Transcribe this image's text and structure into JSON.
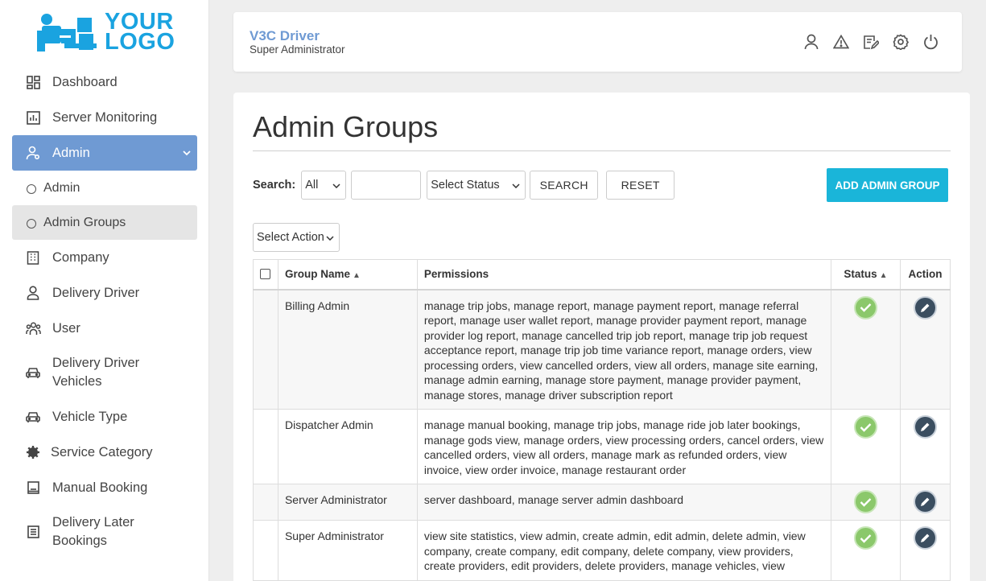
{
  "brand": {
    "logo_line1": "YOUR",
    "logo_line2": "LOGO",
    "accent": "#1aa3e0"
  },
  "sidebar": {
    "items": [
      {
        "label": "Dashboard",
        "icon": "dashboard-icon"
      },
      {
        "label": "Server Monitoring",
        "icon": "chart-icon"
      },
      {
        "label": "Admin",
        "icon": "admin-user-icon",
        "expanded": true
      },
      {
        "label": "Admin",
        "icon": "circle-icon",
        "sub": true
      },
      {
        "label": "Admin Groups",
        "icon": "circle-icon",
        "sub": true,
        "current": true
      },
      {
        "label": "Company",
        "icon": "building-icon"
      },
      {
        "label": "Delivery Driver",
        "icon": "user-icon"
      },
      {
        "label": "User",
        "icon": "users-icon"
      },
      {
        "label": "Delivery Driver Vehicles",
        "icon": "car-icon"
      },
      {
        "label": "Vehicle Type",
        "icon": "car-icon"
      },
      {
        "label": "Service Category",
        "icon": "gear-icon"
      },
      {
        "label": "Manual Booking",
        "icon": "booking-icon"
      },
      {
        "label": "Delivery Later Bookings",
        "icon": "list-icon"
      }
    ]
  },
  "header": {
    "title": "V3C Driver",
    "subtitle": "Super Administrator",
    "icons": [
      "profile-icon",
      "warning-icon",
      "edit-note-icon",
      "settings-icon",
      "power-icon"
    ]
  },
  "main": {
    "title": "Admin Groups",
    "search_label": "Search:",
    "search_field_value": "All",
    "search_input_value": "",
    "status_select_value": "Select Status",
    "search_button": "SEARCH",
    "reset_button": "RESET",
    "add_button": "ADD ADMIN GROUP",
    "action_select_value": "Select Action",
    "columns": [
      "Group Name",
      "Permissions",
      "Status",
      "Action"
    ],
    "rows": [
      {
        "name": "Billing Admin",
        "permissions": "manage trip jobs, manage report, manage payment report, manage referral report, manage user wallet report, manage provider payment report, manage provider log report, manage cancelled trip job report, manage trip job request acceptance report, manage trip job time variance report, manage orders, view processing orders, view cancelled orders, view all orders, manage site earning, manage admin earning, manage store payment, manage provider payment, manage stores, manage driver subscription report"
      },
      {
        "name": "Dispatcher Admin",
        "permissions": "manage manual booking, manage trip jobs, manage ride job later bookings, manage gods view, manage orders, view processing orders, cancel orders, view cancelled orders, view all orders, manage mark as refunded orders, view invoice, view order invoice, manage restaurant order"
      },
      {
        "name": "Server Administrator",
        "permissions": "server dashboard, manage server admin dashboard"
      },
      {
        "name": "Super Administrator",
        "permissions": "view site statistics, view admin, create admin, edit admin, delete admin, view company, create company, edit company, delete company, view providers, create providers, edit providers, delete providers, manage vehicles, view"
      }
    ]
  }
}
